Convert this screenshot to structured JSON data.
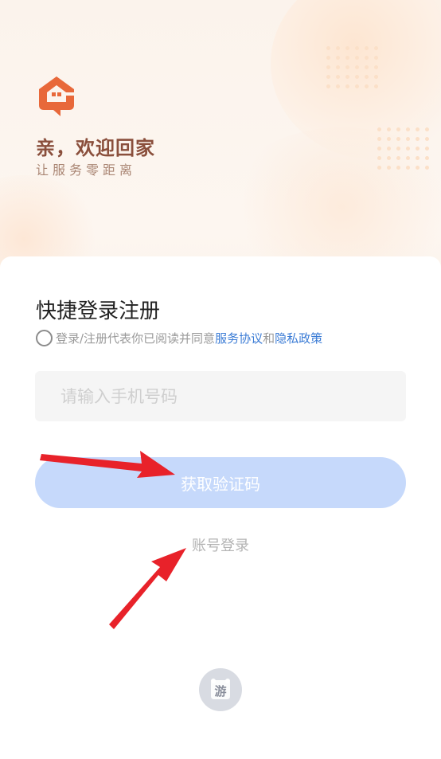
{
  "header": {
    "logo_icon": "house-chat-bubble-icon",
    "welcome_text": "亲，欢迎回家",
    "slogan_text": "让服务零距离"
  },
  "login": {
    "title": "快捷登录注册",
    "agreement": {
      "prefix": "登录/注册代表你已阅读并同意",
      "service_link": "服务协议",
      "and": "和",
      "privacy_link": "隐私政策"
    },
    "phone_placeholder": "请输入手机号码",
    "get_code_label": "获取验证码",
    "account_login_label": "账号登录"
  },
  "footer": {
    "badge_text": "游",
    "badge_icon": "game-badge-icon"
  },
  "colors": {
    "accent_orange": "#e8683a",
    "link_blue": "#3a7bd5",
    "button_bg": "#c6d9fb",
    "annotation_red": "#e8222a"
  }
}
